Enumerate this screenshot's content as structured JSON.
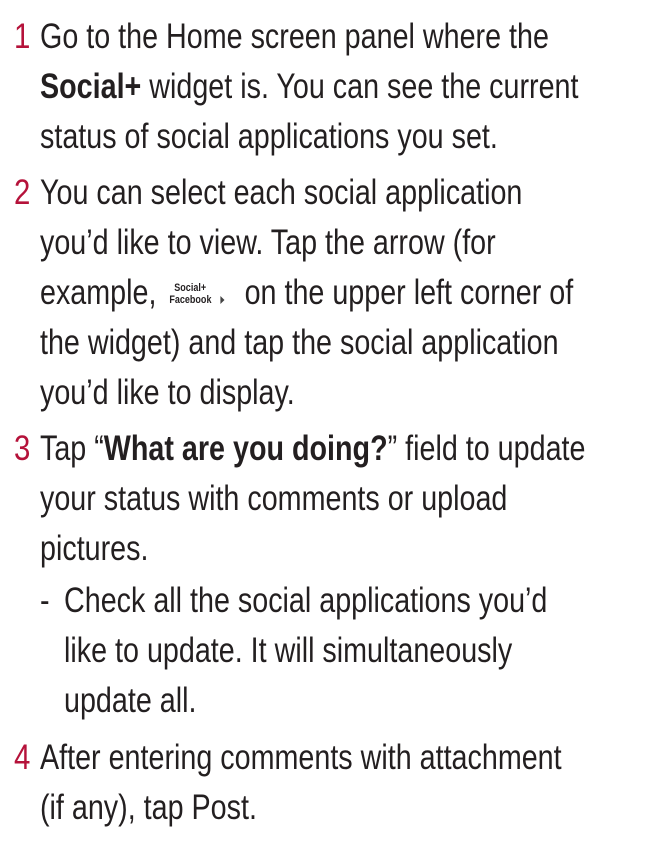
{
  "steps": [
    {
      "number": "1",
      "lines": [
        {
          "text": "Go to the Home screen panel where the"
        },
        {
          "bold": "Social+",
          "after": " widget is. You can see the current"
        },
        {
          "text": "status of social applications you set."
        }
      ]
    },
    {
      "number": "2",
      "lines": [
        {
          "text": "You can select each social application"
        },
        {
          "text": "you’d like to view. Tap the arrow (for"
        },
        {
          "before": "example, ",
          "after": " on the upper left corner of"
        },
        {
          "text": "the widget) and tap the social application"
        },
        {
          "text": "you’d like to display."
        }
      ],
      "widget_icon": {
        "line1": "Social+",
        "line2": "Facebook",
        "icon": "chevron-right-icon"
      }
    },
    {
      "number": "3",
      "lines": [
        {
          "before": "Tap “",
          "bold": "What are you doing?",
          "after": "” field to update"
        },
        {
          "text": "your status with comments or upload"
        },
        {
          "text": "pictures."
        }
      ],
      "sub": {
        "dash": "-",
        "lines": [
          {
            "text": "Check all the social applications you’d"
          },
          {
            "text": "like to update. It will simultaneously"
          },
          {
            "text": "update all."
          }
        ]
      }
    },
    {
      "number": "4",
      "lines": [
        {
          "text": "After entering comments with attachment"
        },
        {
          "text": "(if any), tap Post."
        }
      ]
    }
  ],
  "colors": {
    "step_number": "#b5123a",
    "text": "#231f20"
  }
}
